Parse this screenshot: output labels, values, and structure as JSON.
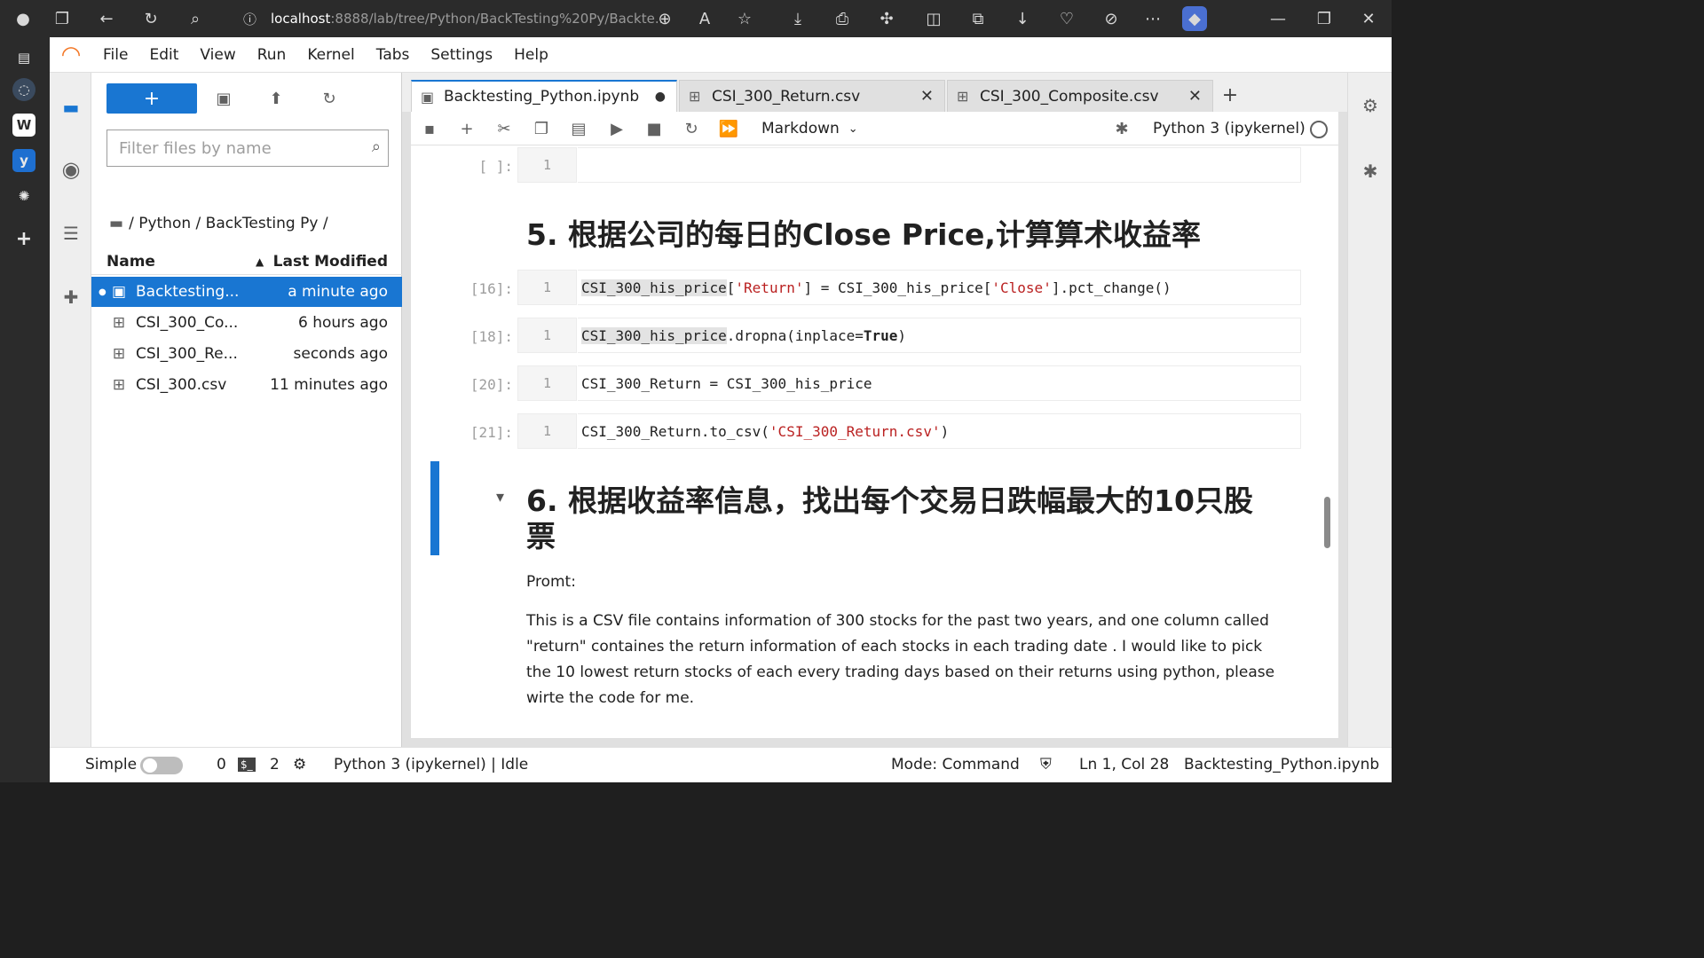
{
  "browser": {
    "url_host": "localhost",
    "url_path": ":8888/lab/tree/Python/BackTesting%20Py/Backte..."
  },
  "menu": [
    "File",
    "Edit",
    "View",
    "Run",
    "Kernel",
    "Tabs",
    "Settings",
    "Help"
  ],
  "filebrowser": {
    "new_label": "+",
    "filter_placeholder": "Filter files by name",
    "breadcrumb": "/ Python / BackTesting Py /",
    "col_name": "Name",
    "col_modified": "Last Modified",
    "files": [
      {
        "name": "Backtesting...",
        "modified": "a minute ago",
        "icon": "notebook-icon",
        "selected": true
      },
      {
        "name": "CSI_300_Co...",
        "modified": "6 hours ago",
        "icon": "spreadsheet-icon",
        "selected": false
      },
      {
        "name": "CSI_300_Re...",
        "modified": "seconds ago",
        "icon": "spreadsheet-icon",
        "selected": false
      },
      {
        "name": "CSI_300.csv",
        "modified": "11 minutes ago",
        "icon": "spreadsheet-icon",
        "selected": false
      }
    ]
  },
  "tabs": [
    {
      "label": "Backtesting_Python.ipynb",
      "icon": "notebook-icon",
      "close": "●"
    },
    {
      "label": "CSI_300_Return.csv",
      "icon": "spreadsheet-icon",
      "close": "✕"
    },
    {
      "label": "CSI_300_Composite.csv",
      "icon": "spreadsheet-icon",
      "close": "✕"
    }
  ],
  "toolbar": {
    "cell_type": "Markdown",
    "kernel": "Python 3 (ipykernel)"
  },
  "cells": {
    "c0": {
      "prompt": "[ ]:",
      "line": "1"
    },
    "h5": "5. 根据公司的每日的Close Price,计算算术收益率",
    "c16": {
      "prompt": "[16]:",
      "line": "1"
    },
    "c18": {
      "prompt": "[18]:",
      "line": "1"
    },
    "c20": {
      "prompt": "[20]:",
      "line": "1",
      "code": "CSI_300_Return = CSI_300_his_price"
    },
    "c21": {
      "prompt": "[21]:",
      "line": "1"
    },
    "h6_line1": "6. 根据收益率信息，找出每个交易日跌幅最大的10只股",
    "h6_line2": "票",
    "md_label": "Promt:",
    "md_para": "This is a CSV file contains information of 300 stocks for the past two years, and one column called \"return\" containes the return information of each stocks in each trading date . I would like to pick the 10 lowest return stocks of each every trading days based on their returns using python, please wirte the code for me."
  },
  "code_tokens": {
    "c16_a": "CSI_300_his_price",
    "c16_b": "[",
    "c16_c": "'Return'",
    "c16_d": "] = CSI_300_his_price[",
    "c16_e": "'Close'",
    "c16_f": "].pct_change()",
    "c18_a": "CSI_300_his_price",
    "c18_b": ".dropna(inplace=",
    "c18_c": "True",
    "c18_d": ")",
    "c21_a": "CSI_300_Return.to_csv(",
    "c21_b": "'CSI_300_Return.csv'",
    "c21_c": ")"
  },
  "status": {
    "mode_label": "Simple",
    "terminals": "0",
    "kernels": "2",
    "kernel_state": "Python 3 (ipykernel) | Idle",
    "mode": "Mode: Command",
    "cursor": "Ln 1, Col 28",
    "file": "Backtesting_Python.ipynb"
  },
  "colors": {
    "accent": "#1976d2",
    "string": "#ba2121"
  }
}
